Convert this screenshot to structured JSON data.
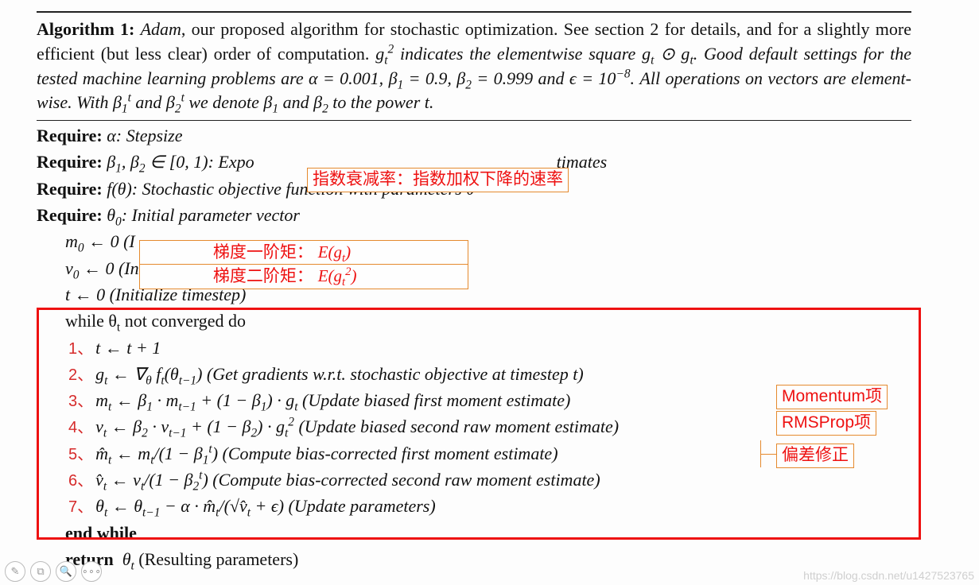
{
  "algorithm": {
    "number": "Algorithm 1:",
    "name": "Adam",
    "caption_after_name": ", our proposed algorithm for stochastic optimization. See section 2 for details, and for a slightly more efficient (but less clear) order of computation. ",
    "caption_gt_html": "g<sub>t</sub><sup>2</sup> indicates the elementwise square g<sub>t</sub> ⊙ g<sub>t</sub>. Good default settings for the tested machine learning problems are α = 0.001, β<sub>1</sub> = 0.9, β<sub>2</sub> = 0.999 and ϵ = 10<sup>−8</sup>. All operations on vectors are element-wise. With β<sub>1</sub><sup>t</sup> and β<sub>2</sub><sup>t</sup> we denote β<sub>1</sub> and β<sub>2</sub> to the power t."
  },
  "require": [
    "α: Stepsize",
    "β<sub>1</sub>, β<sub>2</sub> ∈ [0, 1): Expo",
    "f(θ): Stochastic objective function with parameters θ",
    "θ<sub>0</sub>: Initial parameter vector"
  ],
  "require_tail_after_anno1": "timates",
  "init": [
    "m<sub>0</sub> ← 0 (I",
    "v<sub>0</sub> ← 0 (In",
    "t ← 0 (Initialize timestep)"
  ],
  "loop": {
    "while": "while θ<sub>t</sub> not converged do",
    "steps": [
      "t ← t + 1",
      "g<sub>t</sub> ← ∇<sub>θ</sub> f<sub>t</sub>(θ<sub>t−1</sub>) (Get gradients w.r.t. stochastic objective at timestep t)",
      "m<sub>t</sub> ← β<sub>1</sub> · m<sub>t−1</sub> + (1 − β<sub>1</sub>) · g<sub>t</sub> (Update biased first moment estimate)",
      "v<sub>t</sub> ← β<sub>2</sub> · v<sub>t−1</sub> + (1 − β<sub>2</sub>) · g<sub>t</sub><sup>2</sup> (Update biased second raw moment estimate)",
      "m̂<sub>t</sub> ← m<sub>t</sub>/(1 − β<sub>1</sub><sup>t</sup>) (Compute bias-corrected first moment estimate)",
      "v̂<sub>t</sub> ← v<sub>t</sub>/(1 − β<sub>2</sub><sup>t</sup>) (Compute bias-corrected second raw moment estimate)",
      "θ<sub>t</sub> ← θ<sub>t−1</sub> − α · m̂<sub>t</sub>/(√v̂<sub>t</sub> + ϵ) (Update parameters)"
    ],
    "endwhile": "end while",
    "return": "return  θ<sub>t</sub> (Resulting parameters)"
  },
  "annotations": {
    "decay_rate": "指数衰减率：指数加权下降的速率",
    "first_moment_prefix": "梯度一阶矩：",
    "first_moment_math": "E(g<sub>t</sub>)",
    "second_moment_prefix": "梯度二阶矩：",
    "second_moment_math": "E(g<sub>t</sub><sup>2</sup>)",
    "momentum": "Momentum项",
    "rmsprop": "RMSProp项",
    "bias_corr": "偏差修正"
  },
  "watermark": "https://blog.csdn.net/u1427523765",
  "toolbar": {
    "edit": "✎",
    "group": "⧉",
    "zoom": "🔍",
    "more": "∘∘∘"
  }
}
